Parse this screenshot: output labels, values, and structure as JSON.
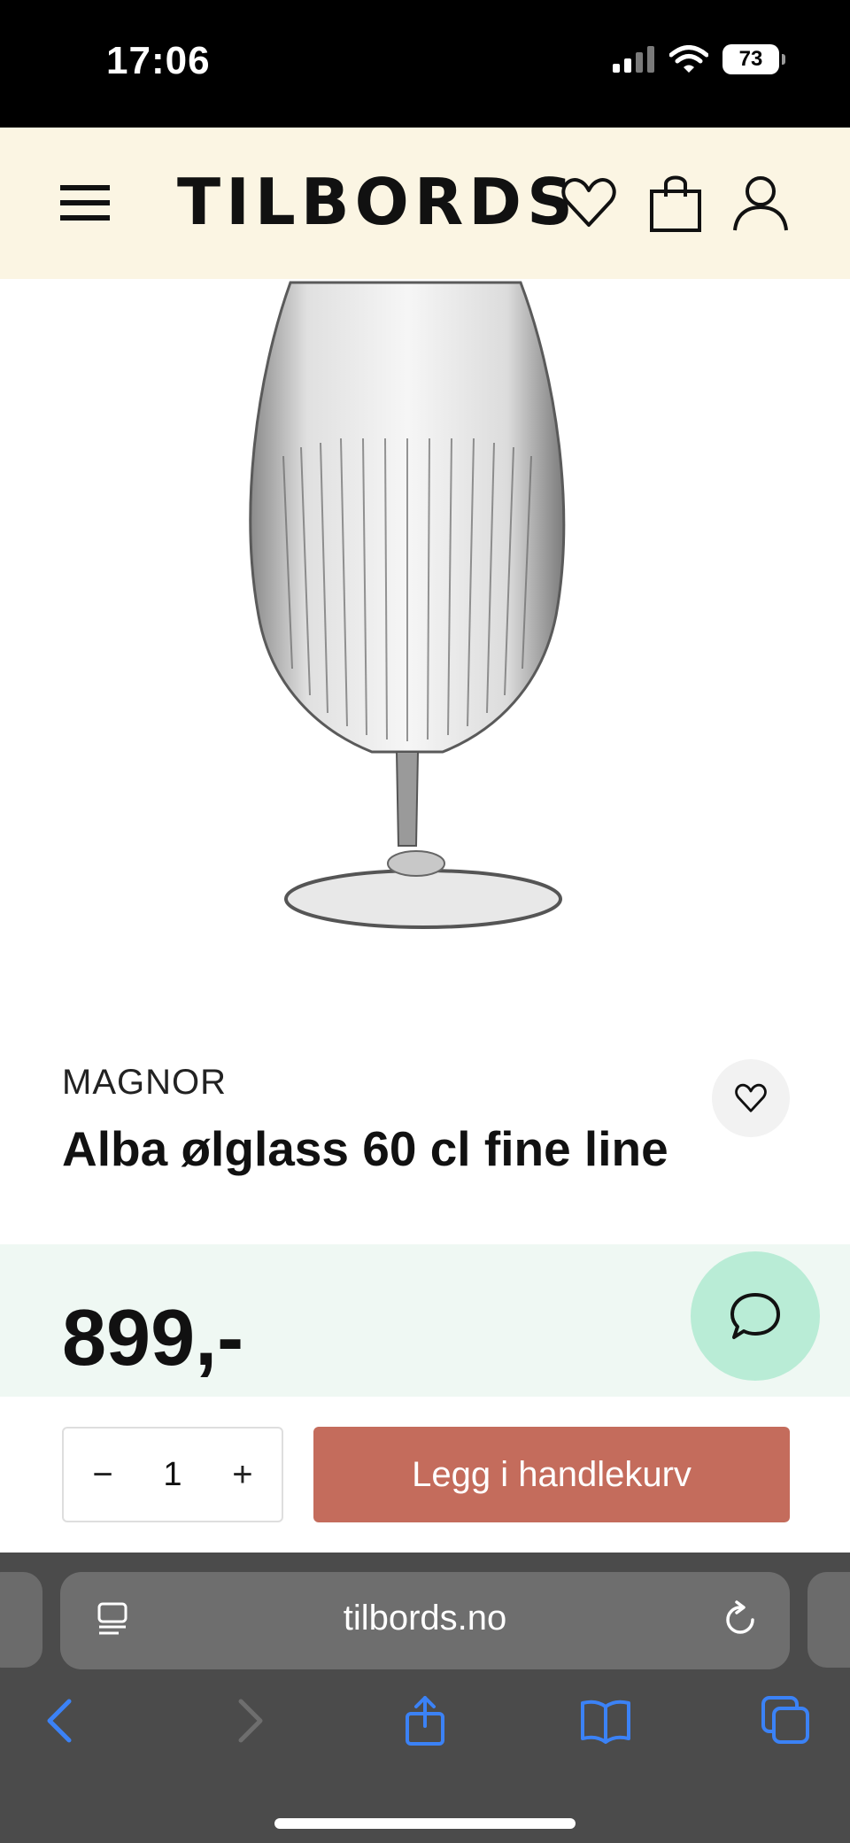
{
  "status_bar": {
    "time": "17:06",
    "battery": "73"
  },
  "header": {
    "logo": "TILBORDS",
    "icons": [
      "menu-icon",
      "heart-icon",
      "shopping-bag-icon",
      "user-icon"
    ]
  },
  "product": {
    "brand": "MAGNOR",
    "title": "Alba ølglass 60 cl fine line",
    "price": "899,-",
    "image_alt": "glass-icon"
  },
  "purchase": {
    "qty_minus": "−",
    "qty_value": "1",
    "qty_plus": "+",
    "cart_label": "Legg i handlekurv"
  },
  "browser": {
    "url": "tilbords.no"
  },
  "colors": {
    "header_bg": "#fbf5e3",
    "price_band_bg": "#eff8f3",
    "chat_bg": "#b9ecd6",
    "cart_button_bg": "#c46c5c",
    "ios_blue": "#3b82f6"
  }
}
